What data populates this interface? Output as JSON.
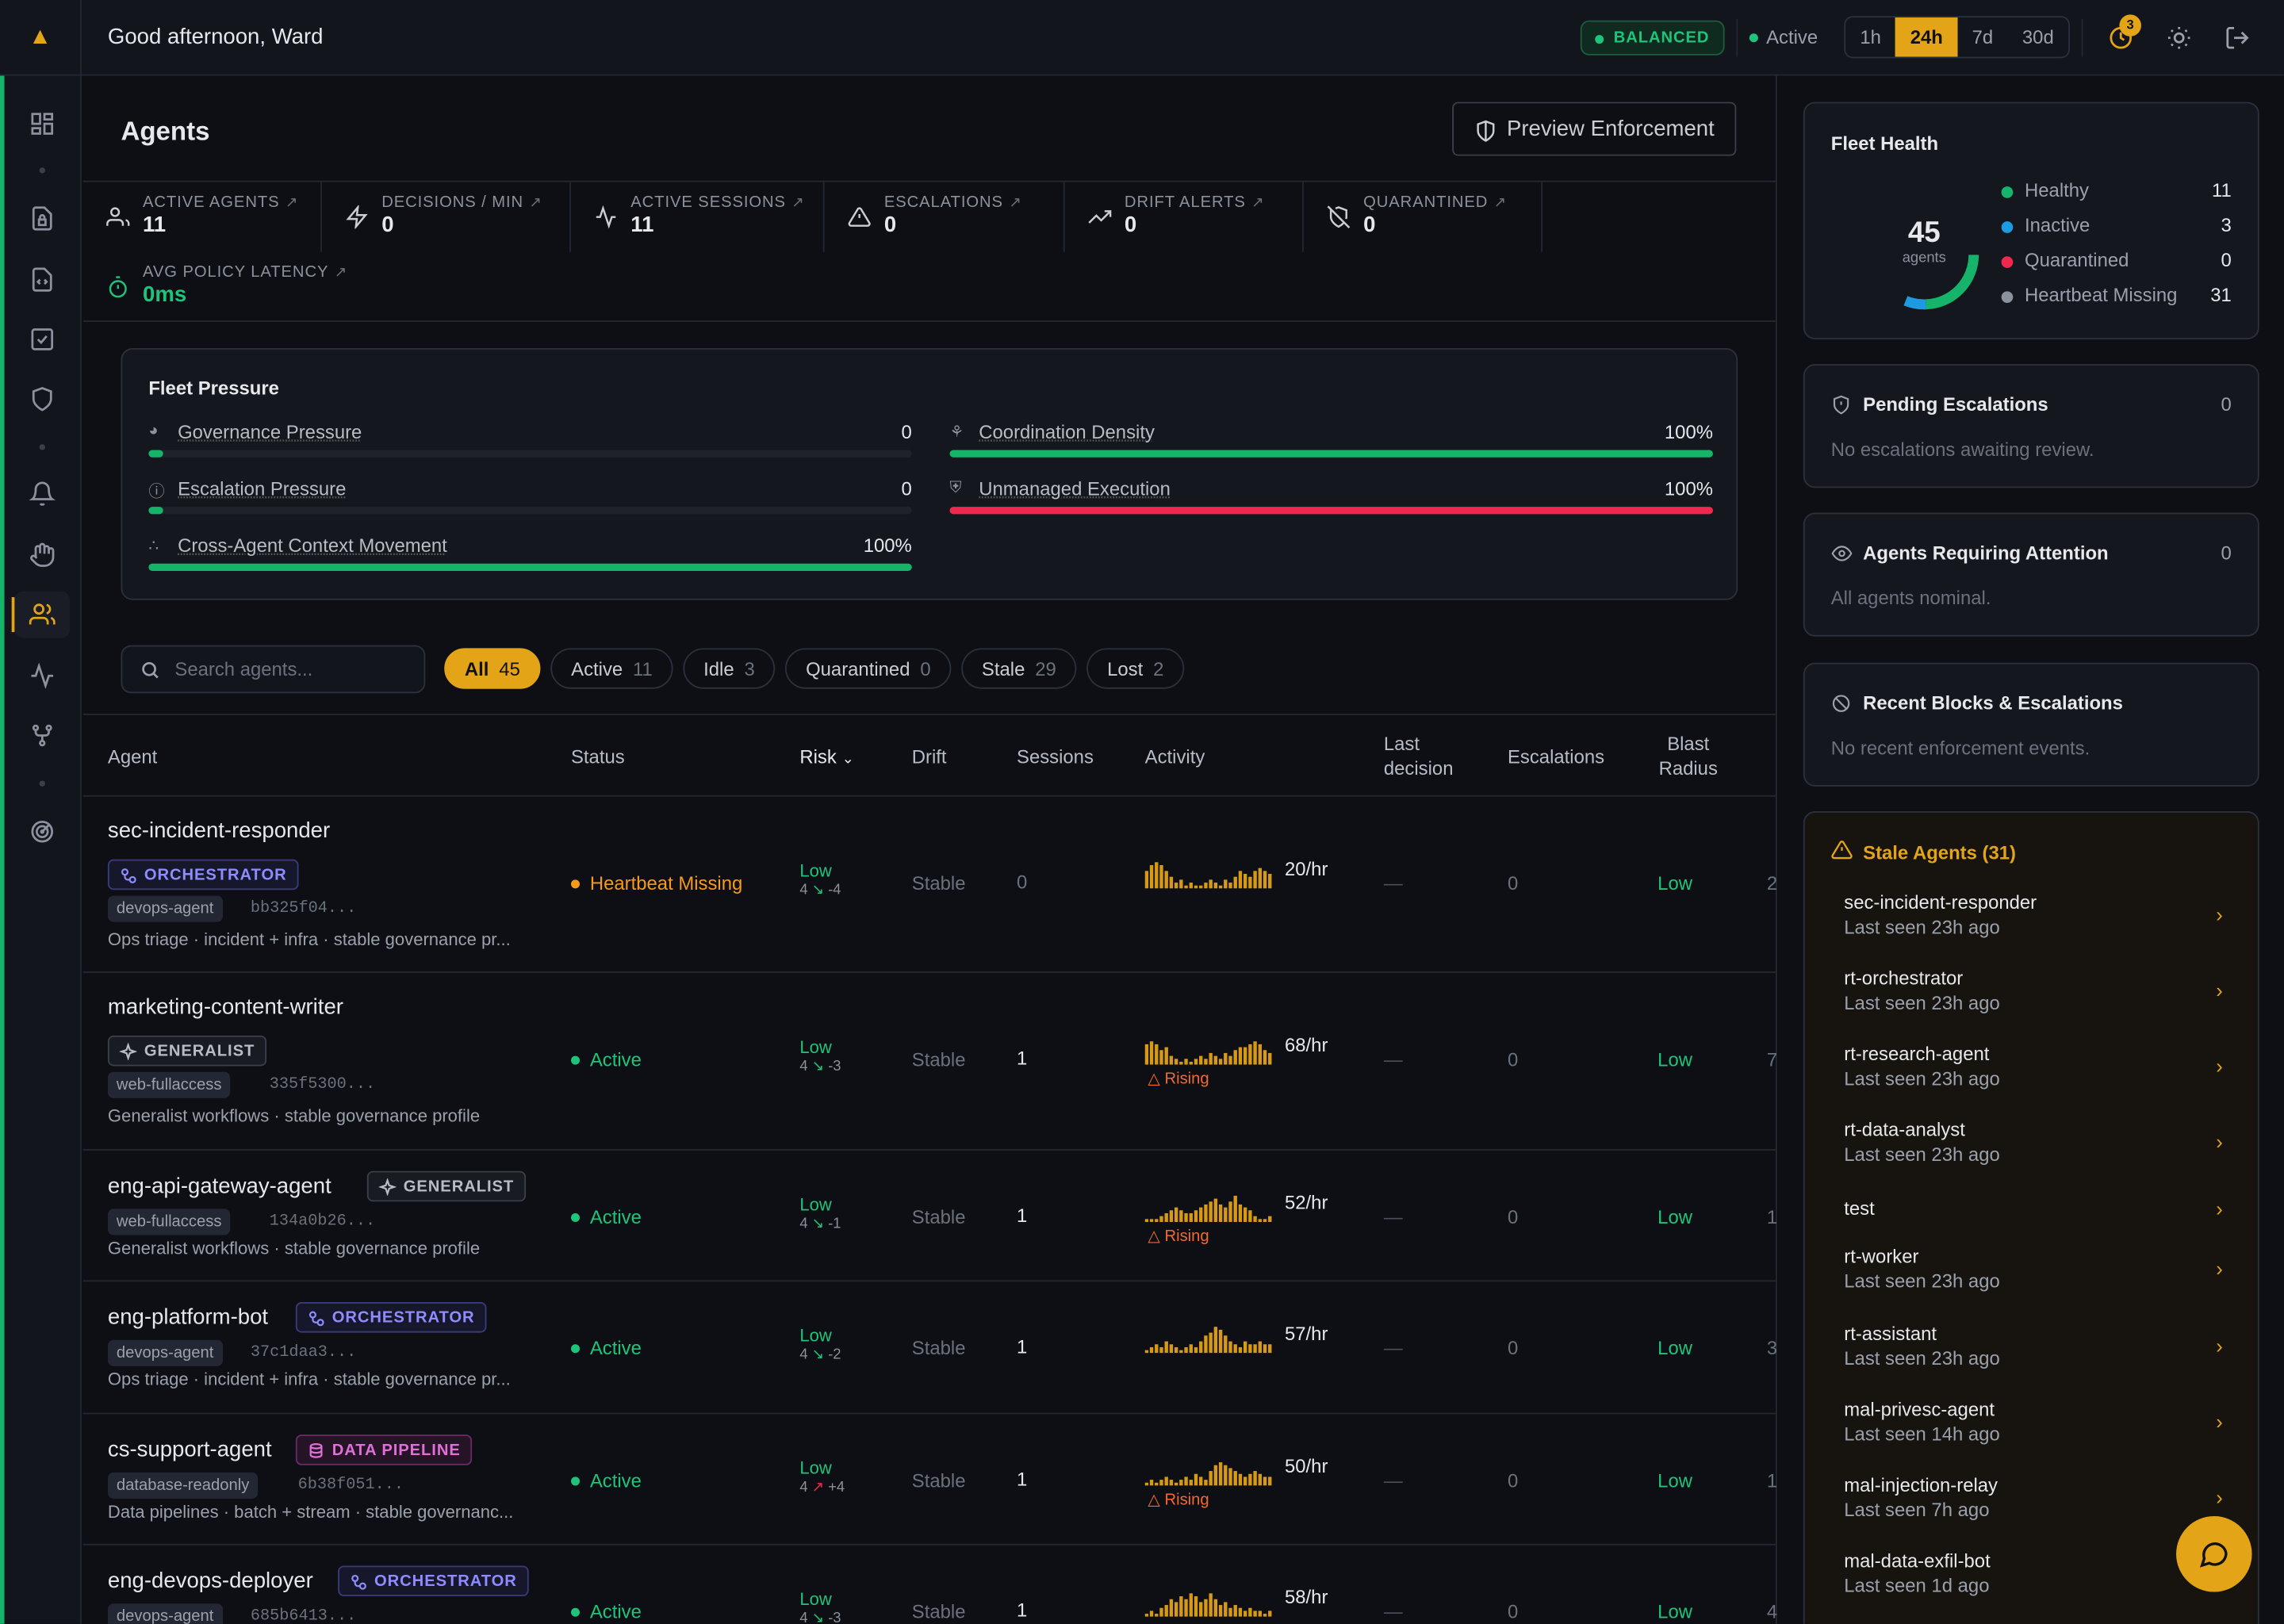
{
  "topbar": {
    "greeting": "Good afternoon, Ward",
    "mode_badge": "BALANCED",
    "status": "Active",
    "ranges": [
      "1h",
      "24h",
      "7d",
      "30d"
    ],
    "active_range": "24h",
    "notif_count": "3"
  },
  "page": {
    "title": "Agents",
    "preview_button": "Preview Enforcement"
  },
  "stats": [
    {
      "label": "ACTIVE AGENTS",
      "value": "11",
      "icon": "users-icon"
    },
    {
      "label": "DECISIONS / MIN",
      "value": "0",
      "icon": "lightning-icon"
    },
    {
      "label": "ACTIVE SESSIONS",
      "value": "11",
      "icon": "pulse-icon"
    },
    {
      "label": "ESCALATIONS",
      "value": "0",
      "icon": "warning-icon"
    },
    {
      "label": "DRIFT ALERTS",
      "value": "0",
      "icon": "trend-up-icon"
    },
    {
      "label": "QUARANTINED",
      "value": "0",
      "icon": "shield-off-icon"
    },
    {
      "label": "AVG POLICY LATENCY",
      "value": "0ms",
      "icon": "stopwatch-icon"
    }
  ],
  "pressure": {
    "title": "Fleet Pressure",
    "items": [
      {
        "name": "Governance Pressure",
        "value": "0",
        "level": 0.01,
        "color": "#16b36a"
      },
      {
        "name": "Coordination Density",
        "value": "100%",
        "level": 1,
        "color": "#16b36a"
      },
      {
        "name": "Escalation Pressure",
        "value": "0",
        "level": 0.01,
        "color": "#16b36a"
      },
      {
        "name": "Unmanaged Execution",
        "value": "100%",
        "level": 1,
        "color": "#f0284f"
      },
      {
        "name": "Cross-Agent Context Movement",
        "value": "100%",
        "level": 1,
        "color": "#16b36a"
      }
    ]
  },
  "filters": {
    "search_placeholder": "Search agents...",
    "chips": [
      {
        "label": "All",
        "count": "45"
      },
      {
        "label": "Active",
        "count": "11"
      },
      {
        "label": "Idle",
        "count": "3"
      },
      {
        "label": "Quarantined",
        "count": "0"
      },
      {
        "label": "Stale",
        "count": "29"
      },
      {
        "label": "Lost",
        "count": "2"
      }
    ]
  },
  "table": {
    "headers": {
      "agent": "Agent",
      "status": "Status",
      "risk": "Risk",
      "drift": "Drift",
      "sessions": "Sessions",
      "activity": "Activity",
      "last_decision": "Last decision",
      "escalations": "Escalations",
      "blast_radius": "Blast Radius"
    },
    "rows": [
      {
        "name": "sec-incident-responder",
        "type": "ORCHESTRATOR",
        "tag": "devops-agent",
        "hash": "bb325f04...",
        "desc": "Ops triage · incident + infra · stable governance pr...",
        "status": "Heartbeat Missing",
        "status_color": "#f59a1b",
        "risk": "Low",
        "risk_sub": "4",
        "risk_delta": "-4",
        "drift": "Stable",
        "sessions": "0",
        "rate": "20/hr",
        "rising": "",
        "last": "—",
        "esc": "0",
        "blast": "Low",
        "cut": "2",
        "spark": [
          6,
          8,
          9,
          8,
          6,
          4,
          2,
          3,
          1,
          2,
          1,
          1,
          2,
          3,
          2,
          1,
          3,
          2,
          4,
          6,
          5,
          4,
          6,
          7,
          6,
          5
        ]
      },
      {
        "name": "marketing-content-writer",
        "type": "GENERALIST",
        "tag": "web-fullaccess",
        "hash": "335f5300...",
        "desc": "Generalist workflows · stable governance profile",
        "status": "Active",
        "status_color": "#1fc47a",
        "risk": "Low",
        "risk_sub": "4",
        "risk_delta": "-3",
        "drift": "Stable",
        "sessions": "1",
        "rate": "68/hr",
        "rising": "Rising",
        "last": "—",
        "esc": "0",
        "blast": "Low",
        "cut": "7",
        "spark": [
          7,
          8,
          7,
          5,
          6,
          3,
          2,
          1,
          2,
          1,
          2,
          3,
          2,
          4,
          3,
          2,
          4,
          3,
          5,
          6,
          6,
          7,
          8,
          7,
          5,
          4
        ]
      },
      {
        "name": "eng-api-gateway-agent",
        "type": "GENERALIST",
        "tag": "web-fullaccess",
        "hash": "134a0b26...",
        "desc": "Generalist workflows · stable governance profile",
        "status": "Active",
        "status_color": "#1fc47a",
        "risk": "Low",
        "risk_sub": "4",
        "risk_delta": "-1",
        "drift": "Stable",
        "sessions": "1",
        "rate": "52/hr",
        "rising": "Rising",
        "last": "—",
        "esc": "0",
        "blast": "Low",
        "cut": "1",
        "spark": [
          1,
          1,
          1,
          2,
          3,
          4,
          5,
          4,
          3,
          3,
          4,
          5,
          6,
          7,
          8,
          6,
          5,
          7,
          9,
          6,
          5,
          4,
          2,
          1,
          1,
          2
        ]
      },
      {
        "name": "eng-platform-bot",
        "type": "ORCHESTRATOR",
        "tag": "devops-agent",
        "hash": "37c1daa3...",
        "desc": "Ops triage · incident + infra · stable governance pr...",
        "status": "Active",
        "status_color": "#1fc47a",
        "risk": "Low",
        "risk_sub": "4",
        "risk_delta": "-2",
        "drift": "Stable",
        "sessions": "1",
        "rate": "57/hr",
        "rising": "",
        "last": "—",
        "esc": "0",
        "blast": "Low",
        "cut": "3",
        "spark": [
          1,
          2,
          3,
          2,
          4,
          3,
          2,
          1,
          2,
          3,
          2,
          4,
          6,
          7,
          9,
          8,
          6,
          4,
          3,
          2,
          4,
          3,
          3,
          4,
          3,
          3
        ]
      },
      {
        "name": "cs-support-agent",
        "type": "DATA PIPELINE",
        "tag": "database-readonly",
        "hash": "6b38f051...",
        "desc": "Data pipelines · batch + stream · stable governanc...",
        "status": "Active",
        "status_color": "#1fc47a",
        "risk": "Low",
        "risk_sub": "4",
        "risk_delta": "+4",
        "drift": "Stable",
        "sessions": "1",
        "rate": "50/hr",
        "rising": "Rising",
        "last": "—",
        "esc": "0",
        "blast": "Low",
        "cut": "1",
        "spark": [
          1,
          2,
          1,
          2,
          3,
          2,
          1,
          2,
          3,
          2,
          4,
          3,
          2,
          5,
          7,
          8,
          7,
          6,
          5,
          4,
          3,
          4,
          5,
          4,
          3,
          3
        ]
      },
      {
        "name": "eng-devops-deployer",
        "type": "ORCHESTRATOR",
        "tag": "devops-agent",
        "hash": "685b6413...",
        "desc": "",
        "status": "Active",
        "status_color": "#1fc47a",
        "risk": "Low",
        "risk_sub": "4",
        "risk_delta": "-3",
        "drift": "Stable",
        "sessions": "1",
        "rate": "58/hr",
        "rising": "",
        "last": "—",
        "esc": "0",
        "blast": "Low",
        "cut": "4",
        "spark": [
          1,
          2,
          1,
          3,
          4,
          6,
          5,
          7,
          6,
          8,
          7,
          5,
          6,
          8,
          6,
          4,
          5,
          3,
          4,
          3,
          2,
          3,
          2,
          2,
          1,
          2
        ]
      }
    ]
  },
  "fleet_health": {
    "title": "Fleet Health",
    "total": "45",
    "unit": "agents",
    "items": [
      {
        "label": "Healthy",
        "count": "11",
        "color": "#16b36a"
      },
      {
        "label": "Inactive",
        "count": "3",
        "color": "#1e9be0"
      },
      {
        "label": "Quarantined",
        "count": "0",
        "color": "#f0284f"
      },
      {
        "label": "Heartbeat Missing",
        "count": "31",
        "color": "#8b919d"
      }
    ]
  },
  "pending": {
    "title": "Pending Escalations",
    "count": "0",
    "empty": "No escalations awaiting review."
  },
  "attention": {
    "title": "Agents Requiring Attention",
    "count": "0",
    "empty": "All agents nominal."
  },
  "recent": {
    "title": "Recent Blocks & Escalations",
    "empty": "No recent enforcement events."
  },
  "stale": {
    "title": "Stale Agents (31)",
    "items": [
      {
        "name": "sec-incident-responder",
        "seen": "Last seen 23h ago"
      },
      {
        "name": "rt-orchestrator",
        "seen": "Last seen 23h ago"
      },
      {
        "name": "rt-research-agent",
        "seen": "Last seen 23h ago"
      },
      {
        "name": "rt-data-analyst",
        "seen": "Last seen 23h ago"
      },
      {
        "name": "test",
        "seen": ""
      },
      {
        "name": "rt-worker",
        "seen": "Last seen 23h ago"
      },
      {
        "name": "rt-assistant",
        "seen": "Last seen 23h ago"
      },
      {
        "name": "mal-privesc-agent",
        "seen": "Last seen 14h ago"
      },
      {
        "name": "mal-injection-relay",
        "seen": "Last seen 7h ago"
      },
      {
        "name": "mal-data-exfil-bot",
        "seen": "Last seen 1d ago"
      }
    ]
  }
}
